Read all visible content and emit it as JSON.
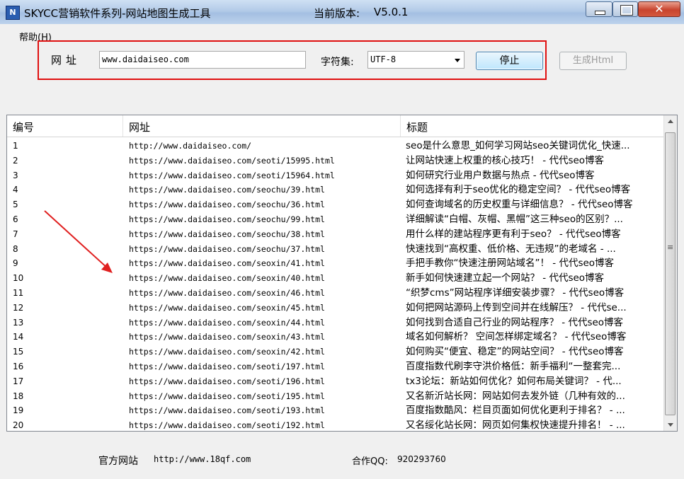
{
  "window": {
    "title": "SKYCC营销软件系列-网站地图生成工具",
    "version_label": "当前版本:",
    "version_value": "V5.0.1",
    "app_icon_letter": "N"
  },
  "menu": {
    "help": "帮助(H)"
  },
  "form": {
    "url_label": "网址",
    "url_value": "www.daidaiseo.com",
    "charset_label": "字符集:",
    "charset_value": "UTF-8",
    "stop_button": "停止",
    "generate_button": "生成Html"
  },
  "table": {
    "columns": [
      "编号",
      "网址",
      "标题"
    ],
    "rows": [
      {
        "no": "1",
        "url": "http://www.daidaiseo.com/",
        "title": "seo是什么意思_如何学习网站seo关键词优化_快速..."
      },
      {
        "no": "2",
        "url": "https://www.daidaiseo.com/seoti/15995.html",
        "title": "让网站快速上权重的核心技巧！ - 代代seo博客"
      },
      {
        "no": "3",
        "url": "https://www.daidaiseo.com/seoti/15964.html",
        "title": "如何研究行业用户数据与热点 - 代代seo博客"
      },
      {
        "no": "4",
        "url": "https://www.daidaiseo.com/seochu/39.html",
        "title": "如何选择有利于seo优化的稳定空间？ - 代代seo博客"
      },
      {
        "no": "5",
        "url": "https://www.daidaiseo.com/seochu/36.html",
        "title": "如何查询域名的历史权重与详细信息？ - 代代seo博客"
      },
      {
        "no": "6",
        "url": "https://www.daidaiseo.com/seochu/99.html",
        "title": "详细解读“白帽、灰帽、黑帽”这三种seo的区别？..."
      },
      {
        "no": "7",
        "url": "https://www.daidaiseo.com/seochu/38.html",
        "title": "用什么样的建站程序更有利于seo？ - 代代seo博客"
      },
      {
        "no": "8",
        "url": "https://www.daidaiseo.com/seochu/37.html",
        "title": "快速找到“高权重、低价格、无违规”的老域名 - ..."
      },
      {
        "no": "9",
        "url": "https://www.daidaiseo.com/seoxin/41.html",
        "title": "手把手教你“快速注册网站域名”！ - 代代seo博客"
      },
      {
        "no": "10",
        "url": "https://www.daidaiseo.com/seoxin/40.html",
        "title": "新手如何快速建立起一个网站？ - 代代seo博客"
      },
      {
        "no": "11",
        "url": "https://www.daidaiseo.com/seoxin/46.html",
        "title": "“织梦cms”网站程序详细安装步骤？ - 代代seo博客"
      },
      {
        "no": "12",
        "url": "https://www.daidaiseo.com/seoxin/45.html",
        "title": "如何把网站源码上传到空间并在线解压？ - 代代se..."
      },
      {
        "no": "13",
        "url": "https://www.daidaiseo.com/seoxin/44.html",
        "title": "如何找到合适自己行业的网站程序？ - 代代seo博客"
      },
      {
        "no": "14",
        "url": "https://www.daidaiseo.com/seoxin/43.html",
        "title": "域名如何解析？ 空间怎样绑定域名？ - 代代seo博客"
      },
      {
        "no": "15",
        "url": "https://www.daidaiseo.com/seoxin/42.html",
        "title": "如何购买“便宜、稳定”的网站空间？ - 代代seo博客"
      },
      {
        "no": "16",
        "url": "https://www.daidaiseo.com/seoti/197.html",
        "title": "百度指数代刷李守洪价格低：新手福利“一整套完..."
      },
      {
        "no": "17",
        "url": "https://www.daidaiseo.com/seoti/196.html",
        "title": "tx3论坛：新站如何优化？如何布局关键词？ - 代..."
      },
      {
        "no": "18",
        "url": "https://www.daidaiseo.com/seoti/195.html",
        "title": "又名新沂站长网：网站如何去发外链（几种有效的..."
      },
      {
        "no": "19",
        "url": "https://www.daidaiseo.com/seoti/193.html",
        "title": "百度指数酷风：栏目页面如何优化更利于排名？ - ..."
      },
      {
        "no": "20",
        "url": "https://www.daidaiseo.com/seoti/192.html",
        "title": "又名绥化站长网：网页如何集权快速提升排名！ - ..."
      }
    ]
  },
  "footer": {
    "site_label": "官方网站",
    "site_url": "http://www.18qf.com",
    "qq_label": "合作QQ:",
    "qq_value": "920293760"
  },
  "colors": {
    "highlight_frame": "#e01010",
    "annotation_arrow": "#e02020"
  }
}
